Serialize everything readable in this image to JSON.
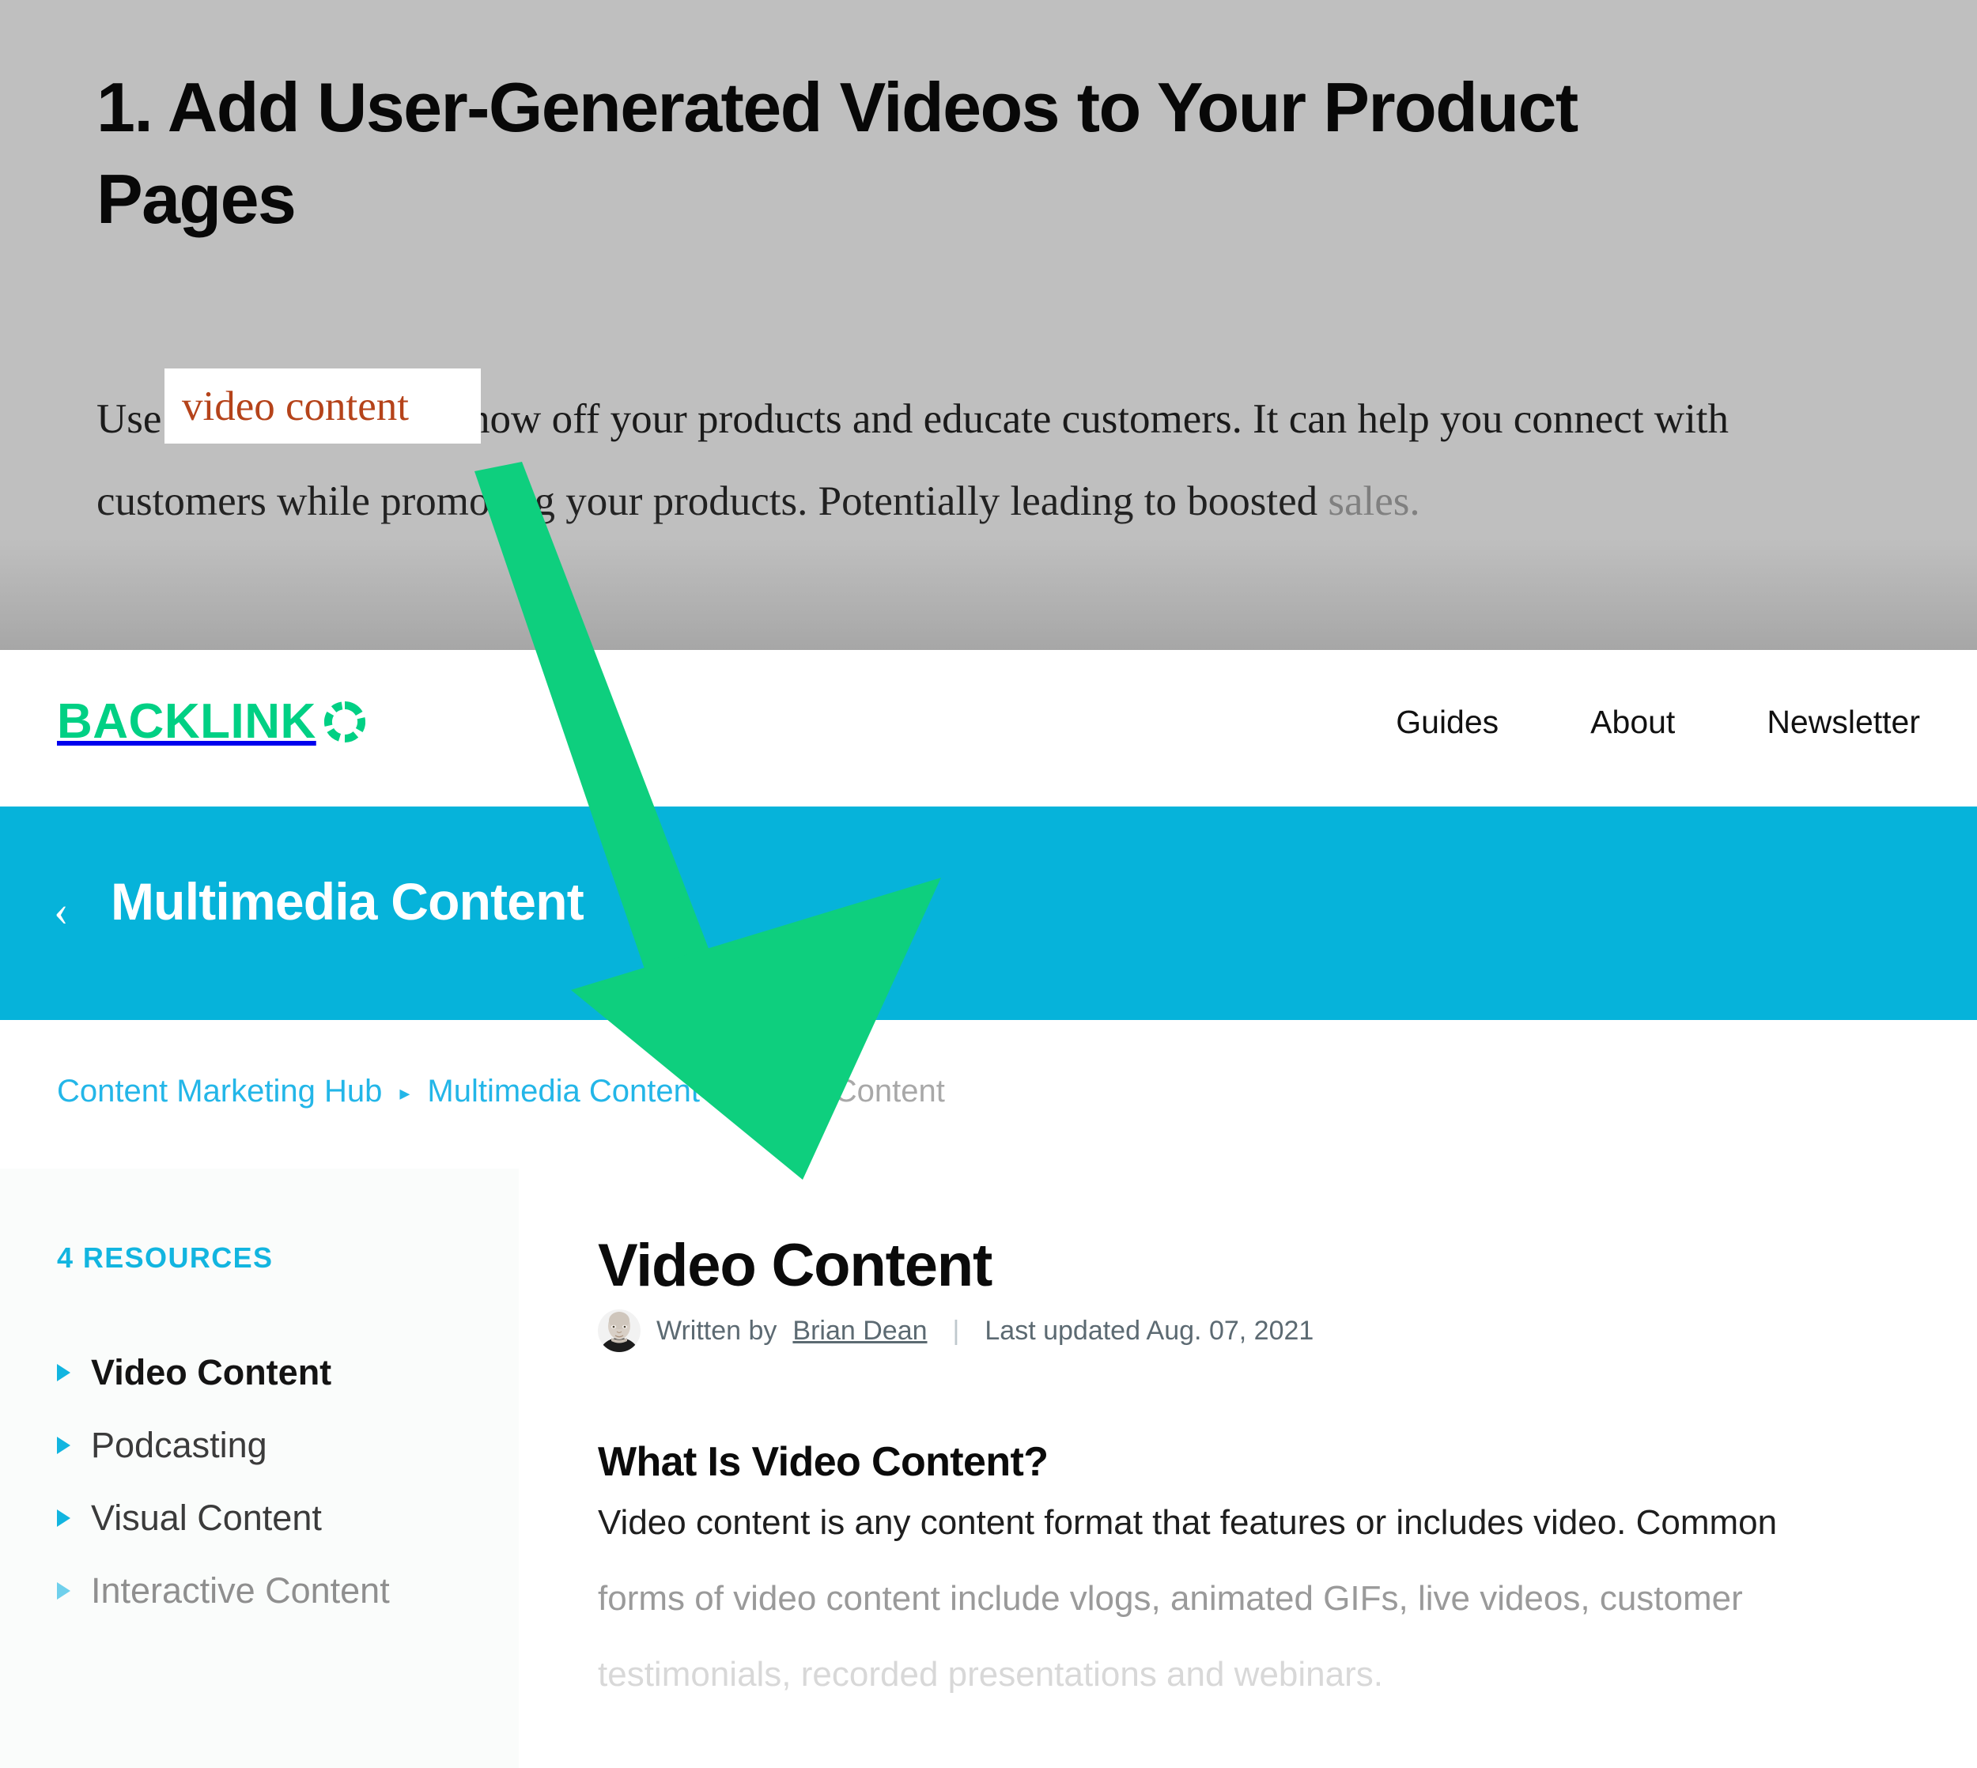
{
  "top_article": {
    "heading": "1. Add User-Generated Videos to Your Product Pages",
    "paragraph_before": "Use ",
    "paragraph_link": "video content",
    "paragraph_after": " to show off your products and educate customers. It can help you connect with customers while promoting your products. Potentially leading to boosted ",
    "paragraph_faded": "sales.",
    "link_color": "#b5431a",
    "overlay_color": "#bfbfbf"
  },
  "callout": {
    "text": "video content",
    "text_color": "#b5431a",
    "background": "#ffffff"
  },
  "header": {
    "logo_text": "BACKLINK",
    "logo_icon": "dashed-ring-o-icon",
    "logo_color": "#00d084",
    "nav": [
      {
        "label": "Guides"
      },
      {
        "label": "About"
      },
      {
        "label": "Newsletter"
      }
    ]
  },
  "hero": {
    "back_icon": "chevron-left-icon",
    "title": "Multimedia Content",
    "background": "#06b3da"
  },
  "breadcrumb": {
    "separator": "▸",
    "items": [
      {
        "label": "Content Marketing Hub",
        "current": false
      },
      {
        "label": "Multimedia Content",
        "current": false
      },
      {
        "label": "Video Content",
        "current": true
      }
    ],
    "link_color": "#23b6e8",
    "current_color": "#a8a8a8"
  },
  "sidebar": {
    "heading": "4 RESOURCES",
    "heading_color": "#12b5e0",
    "items": [
      {
        "label": "Video Content",
        "state": "active"
      },
      {
        "label": "Podcasting",
        "state": "normal"
      },
      {
        "label": "Visual Content",
        "state": "normal"
      },
      {
        "label": "Interactive Content",
        "state": "dim"
      }
    ]
  },
  "main": {
    "title": "Video Content",
    "byline": {
      "avatar_icon": "author-avatar",
      "written_by_label": "Written by",
      "author": "Brian Dean",
      "separator": "|",
      "updated_label": "Last updated Aug. 07, 2021"
    },
    "section_heading": "What Is Video Content?",
    "body_lines": [
      "Video content is any content format that features or includes video. Common",
      "forms of video content include vlogs, animated GIFs, live videos, customer",
      "testimonials, recorded presentations and webinars."
    ]
  },
  "annotation": {
    "shape": "down-right-arrow",
    "color": "#0ecf7e",
    "points_from": "video content link",
    "points_to": "Video Content breadcrumb"
  }
}
